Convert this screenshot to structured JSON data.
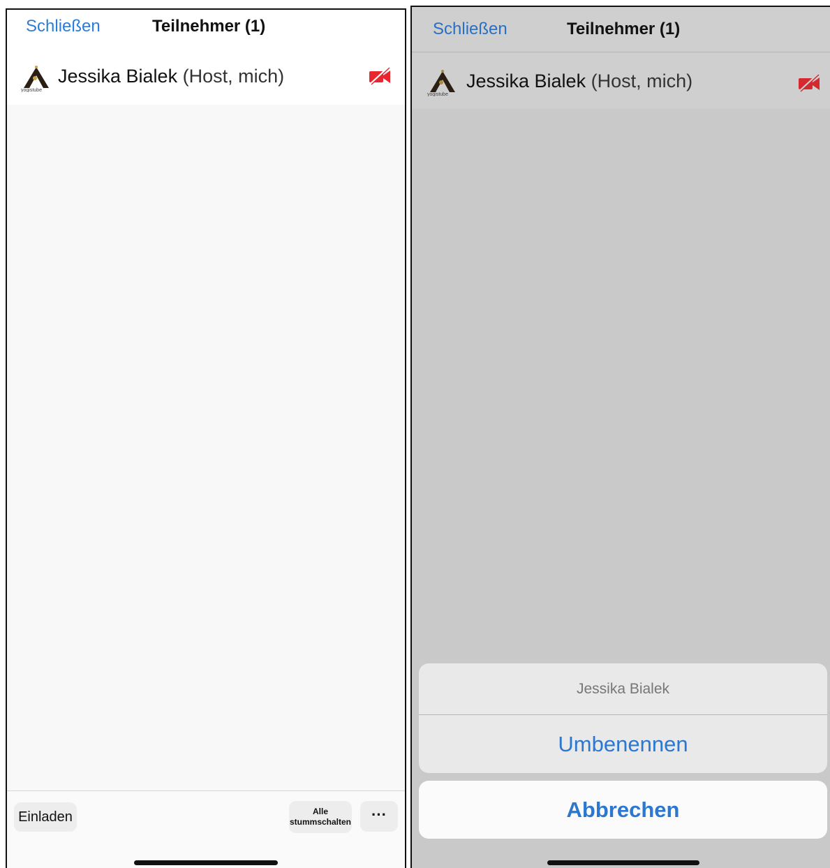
{
  "left_screen": {
    "header": {
      "close_label": "Schließen",
      "title": "Teilnehmer (1)"
    },
    "participant": {
      "name": "Jessika Bialek",
      "role": "(Host, mich)",
      "logo_text": "yogistube",
      "camera_icon": "video-off-icon"
    },
    "toolbar": {
      "invite_label": "Einladen",
      "mute_all_line1": "Alle",
      "mute_all_line2": "stummschalten",
      "more_label": "···"
    }
  },
  "right_screen": {
    "header": {
      "close_label": "Schließen",
      "title": "Teilnehmer (1)"
    },
    "participant": {
      "name": "Jessika Bialek",
      "role": "(Host, mich)",
      "logo_text": "yogistube",
      "camera_icon": "video-off-icon"
    },
    "action_sheet": {
      "title": "Jessika Bialek",
      "rename_label": "Umbenennen",
      "cancel_label": "Abbrechen"
    }
  },
  "colors": {
    "accent": "#2c77cf",
    "video_off": "#e8262e",
    "overlay_gray": "#c9c9c9"
  }
}
